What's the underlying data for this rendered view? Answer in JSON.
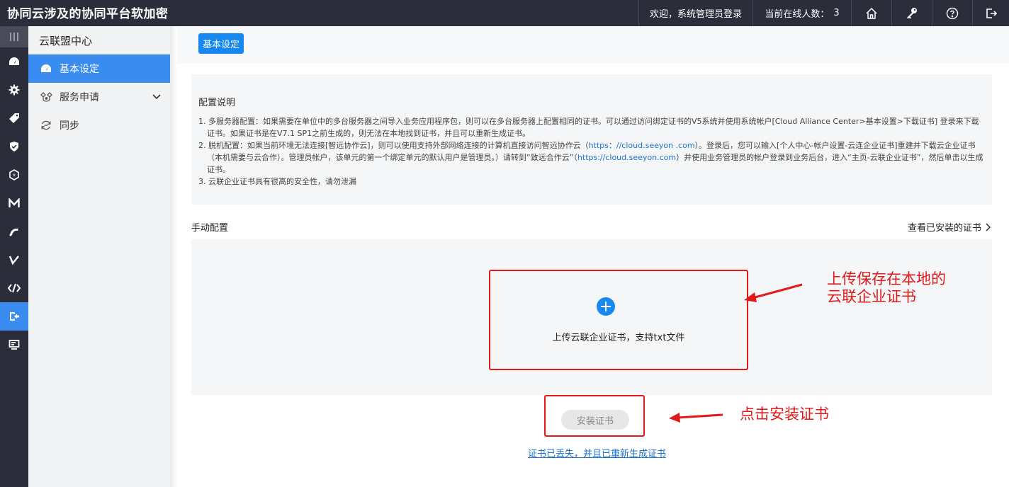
{
  "header": {
    "app_title": "协同云涉及的协同平台软加密",
    "welcome": "欢迎，系统管理员登录",
    "online_label": "当前在线人数：",
    "online_count": "3"
  },
  "sidebar": {
    "title": "云联盟中心",
    "items": [
      {
        "label": "基本设定",
        "icon": "dashboard-icon"
      },
      {
        "label": "服务申请",
        "icon": "service-icon"
      },
      {
        "label": "同步",
        "icon": "sync-icon"
      }
    ]
  },
  "main": {
    "basic_button": "基本设定",
    "desc_title": "配置说明",
    "desc": {
      "item1": "1. 多服务器配置：如果需要在单位中的多台服务器之间导入业务应用程序包，则可以在多台服务器上配置相同的证书。可以通过访问绑定证书的V5系统并使用系统帐户[Cloud Alliance Center>基本设置>下载证书] 登录来下载证书。如果证书是在V7.1 SP1之前生成的，则无法在本地找到证书，并且可以重新生成证书。",
      "item2_a": "2. 脱机配置：如果当前环境无法连接[智远协作云]，则可以使用支持外部网络连接的计算机直接访问智远协作云（",
      "item2_link1": "https：//cloud.seeyon .com",
      "item2_b": "）。登录后，您可以输入[个人中心-帐户设置-云连企业证书]重建并下载云企业证书（本机需要与云合作）。管理员帐户，该单元的第一个绑定单元的默认用户是管理员。）请转到“致远合作云”（",
      "item2_link2": "https://cloud.seeyon.com",
      "item2_c": "）并使用业务管理员的帐户登录到业务后台，进入“主页-云联企业证书”，然后单击以生成证书。",
      "item3": "3. 云联企业证书具有很高的安全性，请勿泄漏"
    },
    "manual_title": "手动配置",
    "view_installed": "查看已安装的证书",
    "upload_text": "上传云联企业证书，支持txt文件",
    "install_button": "安装证书",
    "regen_link": "证书已丢失，并且已重新生成证书"
  },
  "annotations": {
    "note1_line1": "上传保存在本地的",
    "note1_line2": "云联企业证书",
    "note2": "点击安装证书"
  },
  "colors": {
    "topbar": "#2b2d3b",
    "accent": "#1688f0",
    "annotation": "#e21a1a"
  }
}
